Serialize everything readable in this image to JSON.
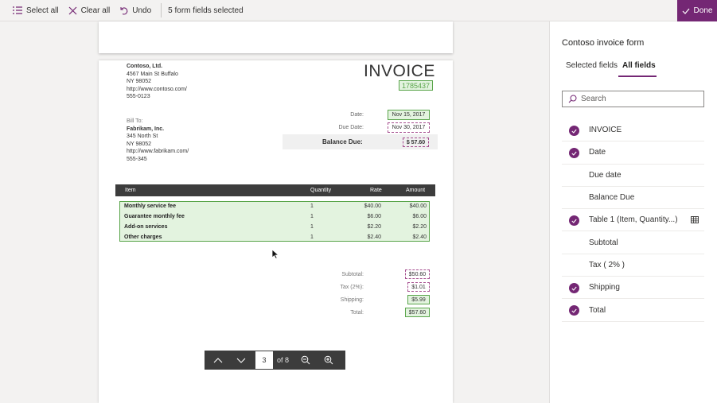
{
  "toolbar": {
    "select_all": "Select all",
    "clear_all": "Clear all",
    "undo": "Undo",
    "status": "5 form fields selected",
    "done": "Done"
  },
  "invoice": {
    "from": {
      "name": "Contoso, Ltd.",
      "address1": "4567 Main St Buffalo",
      "address2": "NY 98052",
      "website": "http://www.contoso.com/",
      "phone": "555-0123"
    },
    "title": "INVOICE",
    "number": "1785437",
    "date_label": "Date:",
    "date_value": "Nov 15, 2017",
    "due_label": "Due Date:",
    "due_value": "Nov 30, 2017",
    "balance_label": "Balance Due:",
    "balance_value": "$ 57.60",
    "bill_to": {
      "caption": "Bill To:",
      "name": "Fabrikam, Inc.",
      "address1": "345 North St",
      "address2": "NY 98052",
      "website": "http://www.fabrikam.com/",
      "phone": "555-345"
    },
    "table_headers": {
      "item": "Item",
      "quantity": "Quantity",
      "rate": "Rate",
      "amount": "Amount"
    },
    "rows": [
      {
        "item": "Monthly service fee",
        "qty": "1",
        "rate": "$40.00",
        "amount": "$40.00"
      },
      {
        "item": "Guarantee monthly fee",
        "qty": "1",
        "rate": "$6.00",
        "amount": "$6.00"
      },
      {
        "item": "Add-on services",
        "qty": "1",
        "rate": "$2.20",
        "amount": "$2.20"
      },
      {
        "item": "Other charges",
        "qty": "1",
        "rate": "$2.40",
        "amount": "$2.40"
      }
    ],
    "subtotal_label": "Subtotal:",
    "subtotal_value": "$50.60",
    "tax_label": "Tax (2%):",
    "tax_value": "$1.01",
    "shipping_label": "Shipping:",
    "shipping_value": "$5.99",
    "total_label": "Total:",
    "total_value": "$57.60"
  },
  "pager": {
    "current": "3",
    "of_label": "of 8"
  },
  "panel": {
    "title": "Contoso invoice form",
    "tab_selected": "Selected fields",
    "tab_all": "All fields",
    "search_placeholder": "Search",
    "fields": [
      {
        "label": "INVOICE",
        "checked": true
      },
      {
        "label": "Date",
        "checked": true
      },
      {
        "label": "Due date",
        "checked": false
      },
      {
        "label": "Balance Due",
        "checked": false
      },
      {
        "label": "Table 1 (Item, Quantity...)",
        "checked": true,
        "icon": "table-icon"
      },
      {
        "label": "Subtotal",
        "checked": false
      },
      {
        "label": "Tax ( 2% )",
        "checked": false
      },
      {
        "label": "Shipping",
        "checked": true
      },
      {
        "label": "Total",
        "checked": true
      }
    ]
  },
  "colors": {
    "accent": "#742774",
    "field_green": "#5aa54b",
    "field_fill": "#e3f3df",
    "dashed": "#a64f8f"
  }
}
